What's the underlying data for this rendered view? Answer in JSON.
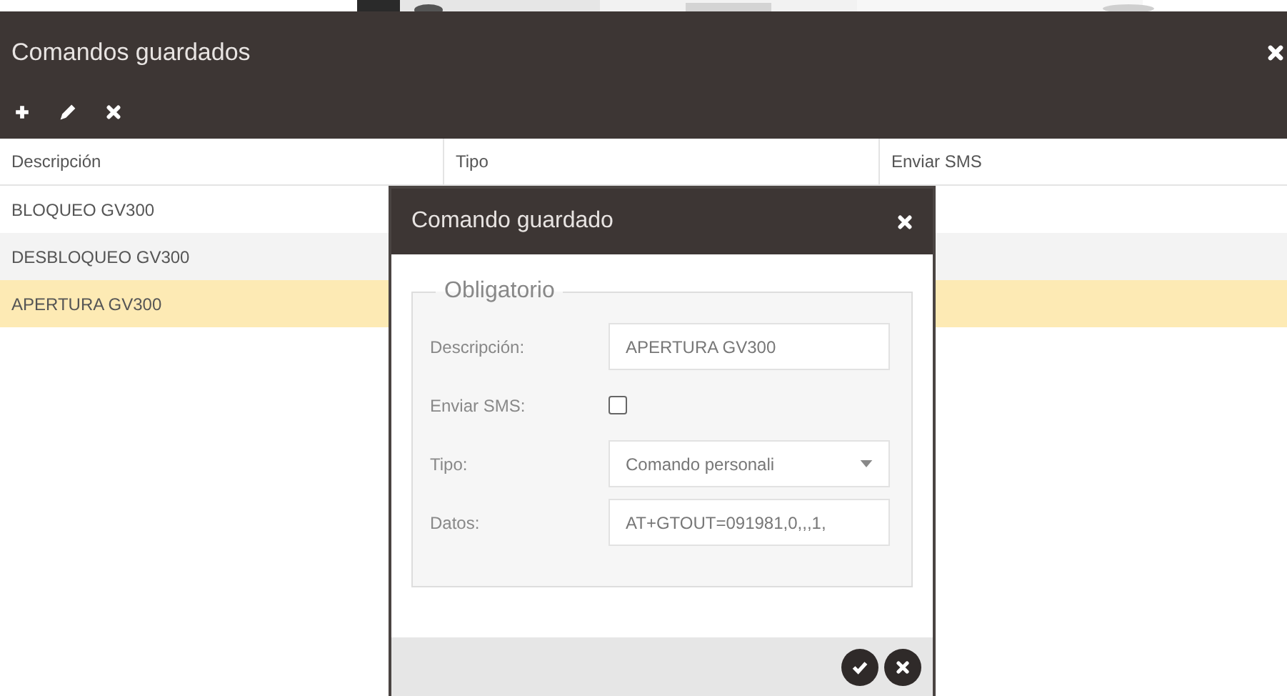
{
  "window": {
    "title": "Comandos guardados"
  },
  "table": {
    "columns": [
      "Descripción",
      "Tipo",
      "Enviar SMS"
    ],
    "rows": [
      {
        "descripcion": "BLOQUEO GV300",
        "selected": false
      },
      {
        "descripcion": "DESBLOQUEO GV300",
        "selected": false
      },
      {
        "descripcion": "APERTURA GV300",
        "selected": true
      }
    ]
  },
  "dialog": {
    "title": "Comando guardado",
    "legend": "Obligatorio",
    "fields": [
      {
        "kind": "text",
        "label": "Descripción:",
        "value": "APERTURA GV300"
      },
      {
        "kind": "checkbox",
        "label": "Enviar SMS:",
        "checked": false
      },
      {
        "kind": "select",
        "label": "Tipo:",
        "value": "Comando personali"
      },
      {
        "kind": "text",
        "label": "Datos:",
        "value": "AT+GTOUT=091981,0,,,1,"
      }
    ]
  }
}
